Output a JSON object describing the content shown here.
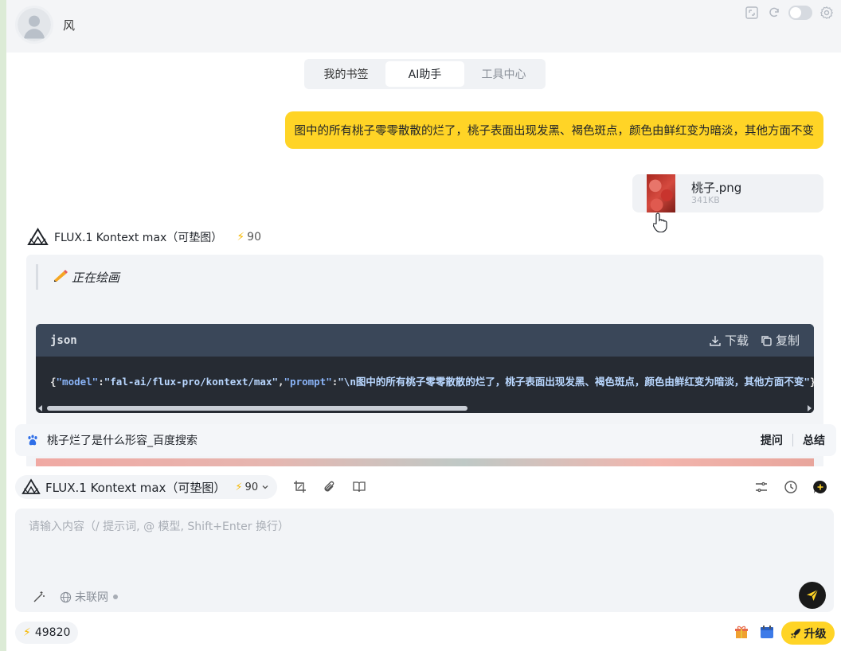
{
  "header": {
    "username": "风",
    "icons": [
      "expand-icon",
      "refresh-icon",
      "theme-toggle",
      "settings-icon"
    ]
  },
  "tabs": [
    {
      "label": "我的书签",
      "active": false
    },
    {
      "label": "AI助手",
      "active": true
    },
    {
      "label": "工具中心",
      "active": false
    }
  ],
  "conversation": {
    "user_message": "图中的所有桃子零零散散的烂了，桃子表面出现发黑、褐色斑点，颜色由鲜红变为暗淡，其他方面不变",
    "attachment": {
      "name": "桃子.png",
      "size": "341KB"
    },
    "model": {
      "name": "FLUX.1 Kontext max（可垫图）",
      "cost": "90"
    },
    "status_text": "正在绘画",
    "code_block": {
      "lang": "json",
      "download_label": "下载",
      "copy_label": "复制",
      "tokens": [
        {
          "t": "{",
          "c": "p"
        },
        {
          "t": "\"model\"",
          "c": "k"
        },
        {
          "t": ":",
          "c": "p"
        },
        {
          "t": "\"fal-ai/flux-pro/kontext/max\"",
          "c": "s"
        },
        {
          "t": ",",
          "c": "p"
        },
        {
          "t": "\"prompt\"",
          "c": "k"
        },
        {
          "t": ":",
          "c": "p"
        },
        {
          "t": "\"\\n图中的所有桃子零零散散的烂了，桃子表面出现发黑、褐色斑点，颜色由鲜红变为暗淡，其他方面不变\"",
          "c": "s"
        },
        {
          "t": "}",
          "c": "p"
        }
      ]
    }
  },
  "suggestion": {
    "text": "桃子烂了是什么形容_百度搜索",
    "ask_label": "提问",
    "summary_label": "总结"
  },
  "composer": {
    "model_name": "FLUX.1 Kontext max（可垫图）",
    "model_cost": "90",
    "placeholder": "请输入内容（/ 提示词, @ 模型, Shift+Enter 换行）",
    "network_label": "未联网"
  },
  "footer": {
    "credits": "49820",
    "upgrade_label": "升级"
  },
  "colors": {
    "accent": "#ffd426",
    "code_header": "#3a4759",
    "code_bg": "#262b33"
  }
}
